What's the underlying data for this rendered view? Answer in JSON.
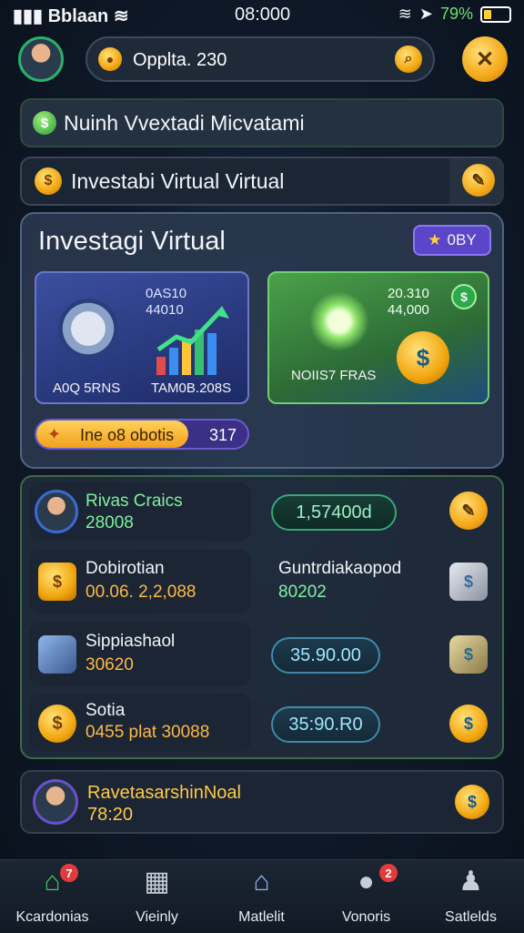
{
  "status_bar": {
    "carrier": "Bblaan",
    "time": "08:000",
    "battery": "79%"
  },
  "header": {
    "search_text": "Opplta. 230"
  },
  "banners": [
    {
      "label": "Nuinh Vvextadi Micvatami"
    },
    {
      "label": "Investabi Virtual Virtual"
    }
  ],
  "panel": {
    "title": "Investagi Virtual",
    "badge": "0BY",
    "card_left": {
      "stat_top": "0AS10",
      "stat_bottom": "44010",
      "caption_left": "A0Q 5RNS",
      "caption_right": "TAM0B.208S"
    },
    "card_right": {
      "stat_top": "20.310",
      "stat_bottom": "44,000",
      "caption": "NOIIS7 FRAS"
    },
    "progress": {
      "label": "Ine o8 obotis",
      "value": "317",
      "fraction": 0.72
    }
  },
  "list_items": [
    {
      "title": "Rivas Craics",
      "subtitle": "28008",
      "value": "1,57400d"
    },
    {
      "title": "Dobirotian",
      "subtitle": "00.06. 2,2,088",
      "side_title": "Guntrdiakaopod",
      "side_sub": "80202"
    },
    {
      "title": "Sippiashaol",
      "subtitle": "30620",
      "value": "35.90.00"
    },
    {
      "title": "Sotia",
      "subtitle": "0455 plat 30088",
      "value": "35:90.R0"
    }
  ],
  "bottom_card": {
    "title": "RavetasarshinNoal",
    "subtitle": "78:20"
  },
  "nav": [
    {
      "label": "Kcardonias",
      "icon": "home-icon",
      "badge": "7"
    },
    {
      "label": "Vieinly",
      "icon": "calculator-icon"
    },
    {
      "label": "Matlelit",
      "icon": "house-icon"
    },
    {
      "label": "Vonoris",
      "icon": "gamepad-icon",
      "badge": "2"
    },
    {
      "label": "Satlelds",
      "icon": "person-icon"
    }
  ],
  "colors": {
    "accent_gold": "#f4a81a",
    "accent_green": "#27b26b",
    "accent_purple": "#6a5bd0"
  }
}
